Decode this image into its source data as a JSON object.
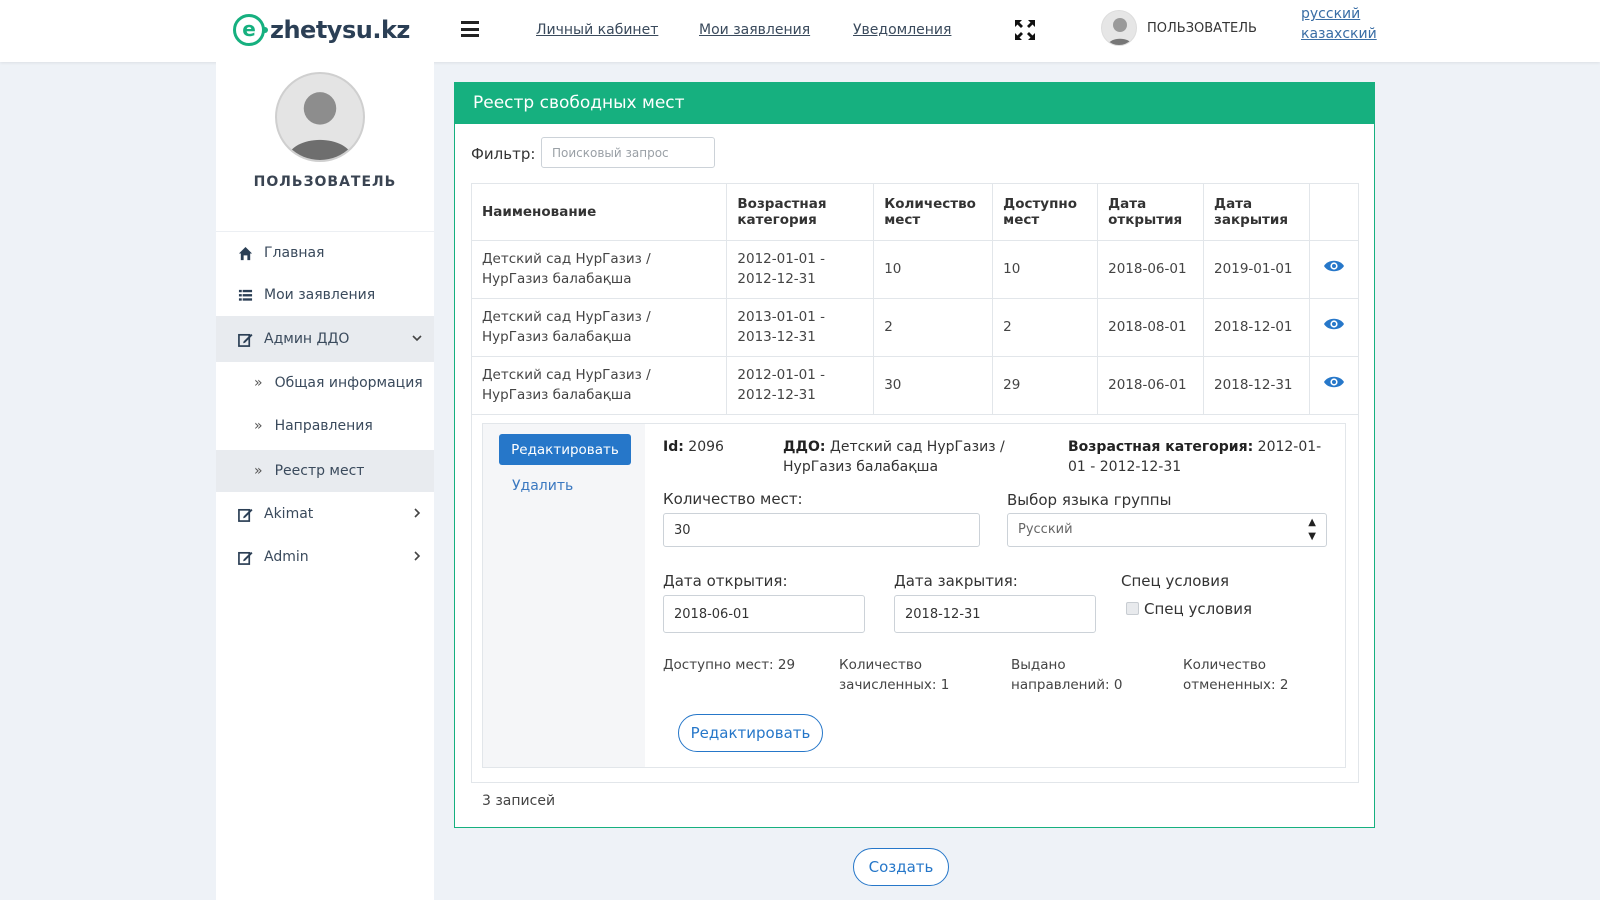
{
  "header": {
    "logo_mark": "e",
    "logo_text": "zhetysu.kz",
    "nav": [
      "Личный кабинет",
      "Мои заявления",
      "Уведомления"
    ],
    "user": "ПОЛЬЗОВАТЕЛЬ",
    "languages": [
      "русский",
      "казахский"
    ]
  },
  "sidebar": {
    "user": "ПОЛЬЗОВАТЕЛЬ",
    "items": [
      {
        "label": "Главная",
        "icon": "home-icon"
      },
      {
        "label": "Мои заявления",
        "icon": "list-icon"
      },
      {
        "label": "Админ ДДО",
        "icon": "edit-icon"
      },
      {
        "label": "Akimat",
        "icon": "edit-icon"
      },
      {
        "label": "Admin",
        "icon": "edit-icon"
      }
    ],
    "subitems": [
      "Общая информация",
      "Направления",
      "Реестр мест"
    ]
  },
  "panel": {
    "title": "Реестр свободных мест",
    "filter_label": "Фильтр:",
    "filter_placeholder": "Поисковый запрос",
    "columns": [
      "Наименование",
      "Возрастная категория",
      "Количество мест",
      "Доступно мест",
      "Дата открытия",
      "Дата закрытия"
    ],
    "rows": [
      {
        "name": "Детский сад НурГазиз / НурГазиз балабақша",
        "age": "2012-01-01 - 2012-12-31",
        "seats": "10",
        "available": "10",
        "open": "2018-06-01",
        "close": "2019-01-01"
      },
      {
        "name": "Детский сад НурГазиз / НурГазиз балабақша",
        "age": "2013-01-01 - 2013-12-31",
        "seats": "2",
        "available": "2",
        "open": "2018-08-01",
        "close": "2018-12-01"
      },
      {
        "name": "Детский сад НурГазиз / НурГазиз балабақша",
        "age": "2012-01-01 - 2012-12-31",
        "seats": "30",
        "available": "29",
        "open": "2018-06-01",
        "close": "2018-12-31"
      }
    ],
    "records": "3 записей",
    "create": "Создать"
  },
  "detail": {
    "edit_button": "Редактировать",
    "delete_link": "Удалить",
    "id_label": "Id:",
    "id_value": "2096",
    "ddo_label": "ДДО:",
    "ddo_value": "Детский сад НурГазиз / НурГазиз балабақша",
    "age_label": "Возрастная категория:",
    "age_value": "2012-01-01 - 2012-12-31",
    "seats_label": "Количество мест:",
    "seats_value": "30",
    "lang_label": "Выбор языка группы",
    "lang_value": "Русский",
    "open_label": "Дата открытия:",
    "open_value": "2018-06-01",
    "close_label": "Дата закрытия:",
    "close_value": "2018-12-31",
    "special_title": "Спец условия",
    "special_checkbox": "Спец условия",
    "available": "Доступно мест: 29",
    "enrolled": "Количество зачисленных: 1",
    "issued": "Выдано направлений: 0",
    "cancelled": "Количество отмененных: 2",
    "edit_button2": "Редактировать"
  },
  "colors": {
    "accent": "#16b07f",
    "primary": "#2677c9"
  }
}
